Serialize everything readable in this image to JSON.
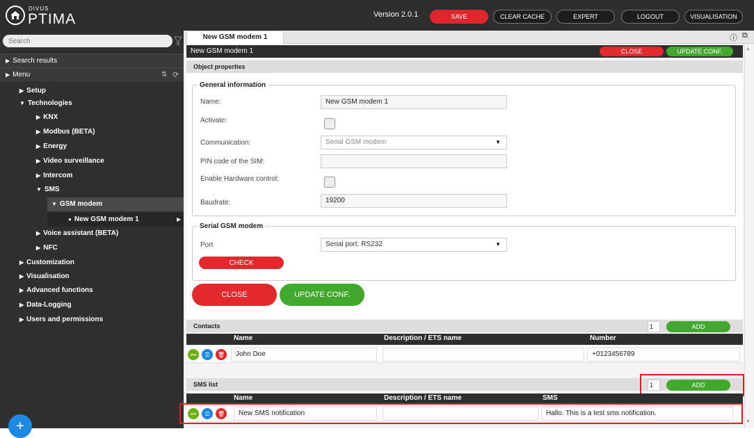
{
  "app": {
    "logo_small": "DIVUS",
    "logo_big": "PTIMA",
    "version": "Version 2.0.1"
  },
  "top_buttons": {
    "save": "SAVE",
    "clear_cache": "CLEAR CACHE",
    "expert": "EXPERT",
    "logout": "LOGOUT",
    "visualisation": "VISUALISATION"
  },
  "sidebar": {
    "search_placeholder": "Search",
    "search_results": "Search results",
    "menu": "Menu",
    "setup": "Setup",
    "technologies": "Technologies",
    "knx": "KNX",
    "modbus": "Modbus (BETA)",
    "energy": "Energy",
    "video": "Video surveillance",
    "intercom": "Intercom",
    "sms": "SMS",
    "gsm_modem": "GSM modem",
    "new_gsm": "New GSM modem 1",
    "voice": "Voice assistant (BETA)",
    "nfc": "NFC",
    "customization": "Customization",
    "visualisation": "Visualisation",
    "advanced": "Advanced functions",
    "datalog": "Data-Logging",
    "users": "Users and permissions"
  },
  "tab": {
    "label": "New GSM modem 1"
  },
  "objbar": {
    "title": "New GSM modem 1",
    "close": "CLOSE",
    "update": "UPDATE CONF."
  },
  "props": {
    "section": "Object properties",
    "general": "General information",
    "name_label": "Name:",
    "name_value": "New GSM modem 1",
    "activate_label": "Activate:",
    "comm_label": "Communication:",
    "comm_value": "Serial GSM modem",
    "pin_label": "PIN code of the SIM:",
    "hw_label": "Enable Hardware control:",
    "baud_label": "Baudrate:",
    "baud_value": "19200",
    "serial": "Serial GSM modem",
    "port_label": "Port",
    "port_value": "Serial port: RS232",
    "check": "CHECK",
    "close": "CLOSE",
    "update": "UPDATE CONF."
  },
  "contacts": {
    "title": "Contacts",
    "count": "1",
    "add": "ADD",
    "columns": [
      "Name",
      "Description / ETS name",
      "Number"
    ],
    "rows": [
      {
        "name": "John Doe",
        "desc": "",
        "number": "+0123456789"
      }
    ]
  },
  "smslist": {
    "title": "SMS list",
    "count": "1",
    "add": "ADD",
    "columns": [
      "Name",
      "Description / ETS name",
      "SMS"
    ],
    "rows": [
      {
        "name": "New SMS notification",
        "desc": "",
        "sms": "Hallo. This is a test sms notification."
      }
    ]
  },
  "colors": {
    "accent_red": "#e2292b",
    "accent_green": "#43a82e",
    "highlight": "#e41c1c"
  }
}
